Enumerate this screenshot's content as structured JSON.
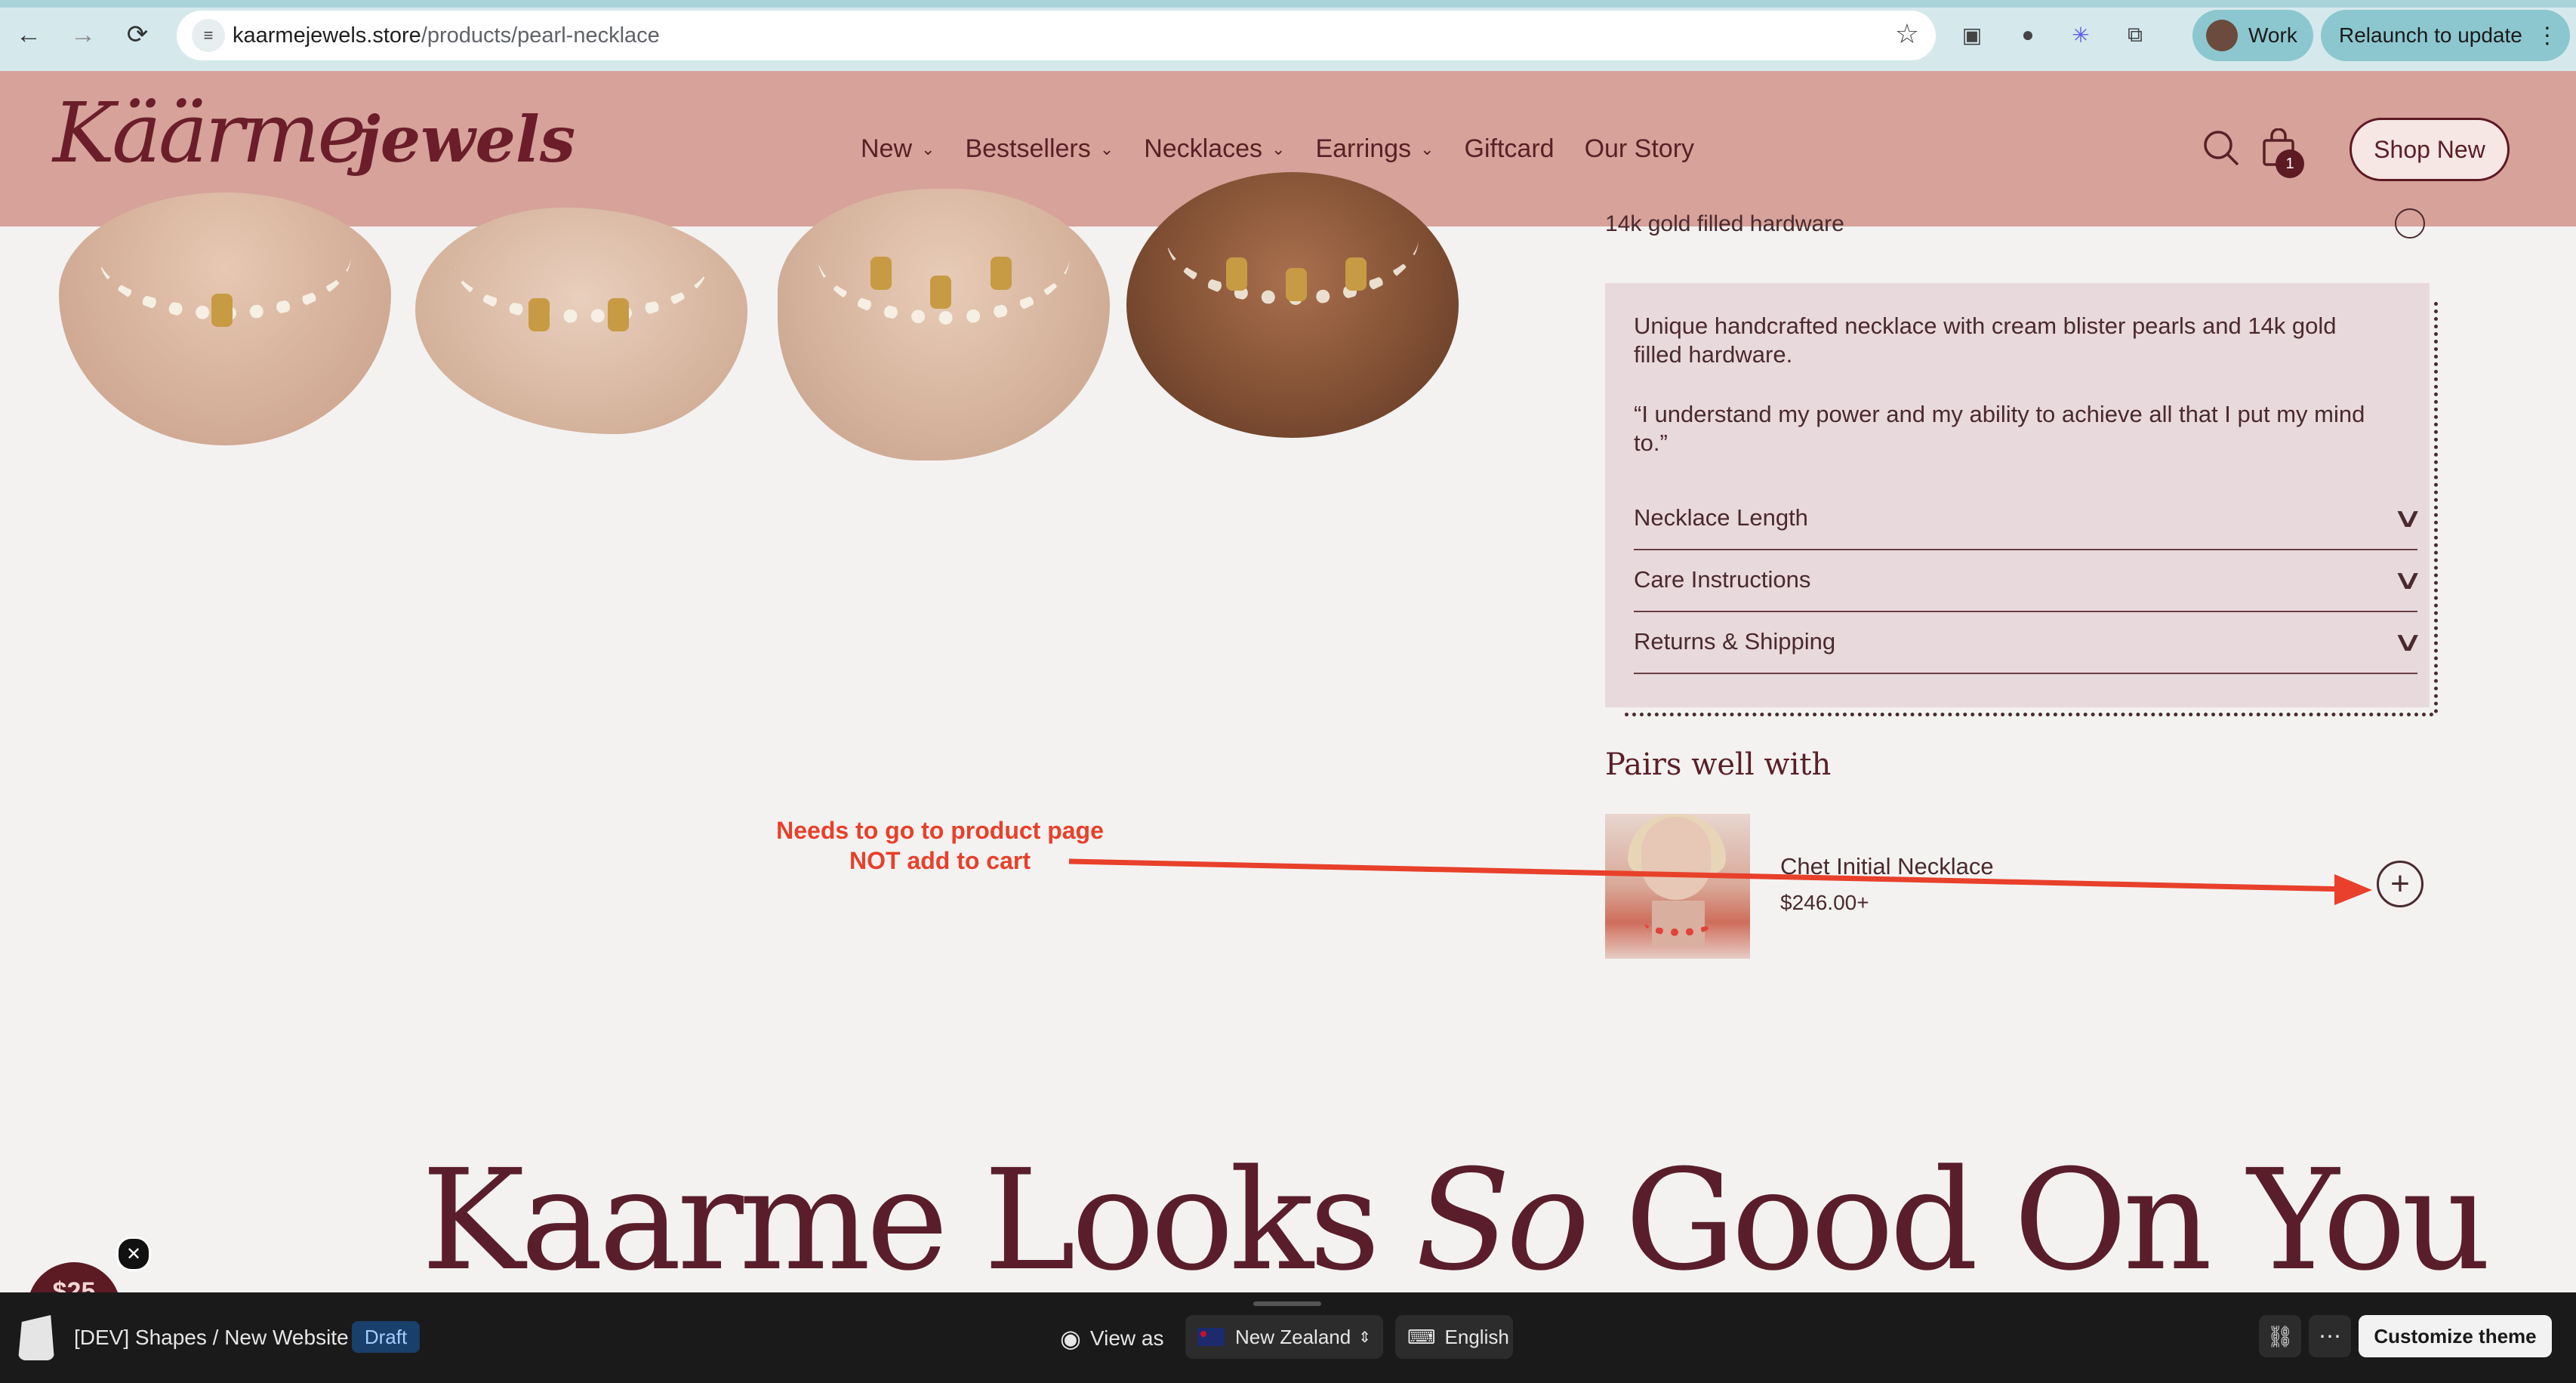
{
  "browser": {
    "url_host": "kaarmejewels.store",
    "url_path": "/products/pearl-necklace",
    "profile": "Work",
    "relaunch": "Relaunch to update",
    "back_icon": "←",
    "forward_icon": "→",
    "reload_icon": "⟳",
    "star_icon": "☆",
    "menu_icon": "⋮"
  },
  "header": {
    "logo_part1": "Käärme",
    "logo_part2": "jewels",
    "nav": [
      {
        "label": "New",
        "has_menu": true
      },
      {
        "label": "Bestsellers",
        "has_menu": true
      },
      {
        "label": "Necklaces",
        "has_menu": true
      },
      {
        "label": "Earrings",
        "has_menu": true
      },
      {
        "label": "Giftcard",
        "has_menu": false
      },
      {
        "label": "Our Story",
        "has_menu": false
      }
    ],
    "chevron": "⌄",
    "cart_count": "1",
    "shop_new": "Shop New"
  },
  "product": {
    "hardware_label": "14k gold filled hardware",
    "description_1": "Unique handcrafted necklace with cream blister pearls and 14k gold filled hardware.",
    "description_2": "“I understand my power and my ability to achieve all that I put my mind to.”",
    "accordions": [
      {
        "label": "Necklace Length"
      },
      {
        "label": "Care Instructions"
      },
      {
        "label": "Returns & Shipping"
      }
    ],
    "accordion_chevron": "∨"
  },
  "pairs": {
    "title": "Pairs well with",
    "item_name": "Chet Initial Necklace",
    "item_price": "$246.00+",
    "add_icon": "+"
  },
  "annotation": {
    "line1": "Needs to go to product page",
    "line2": "NOT add to cart",
    "color": "#e8402a"
  },
  "section": {
    "heading_pre": "Kaarme Looks ",
    "heading_em": "So",
    "heading_post": " Good On You"
  },
  "promo": {
    "label": "$25",
    "close": "✕"
  },
  "shopify_bar": {
    "title": "[DEV] Shapes / New Website",
    "badge": "Draft",
    "view_as": "View as",
    "country": "New Zealand",
    "language": "English",
    "customize": "Customize theme"
  },
  "colors": {
    "header_bg": "#d6a29a",
    "brand": "#5c1a23",
    "page_bg": "#f3f2f1"
  }
}
